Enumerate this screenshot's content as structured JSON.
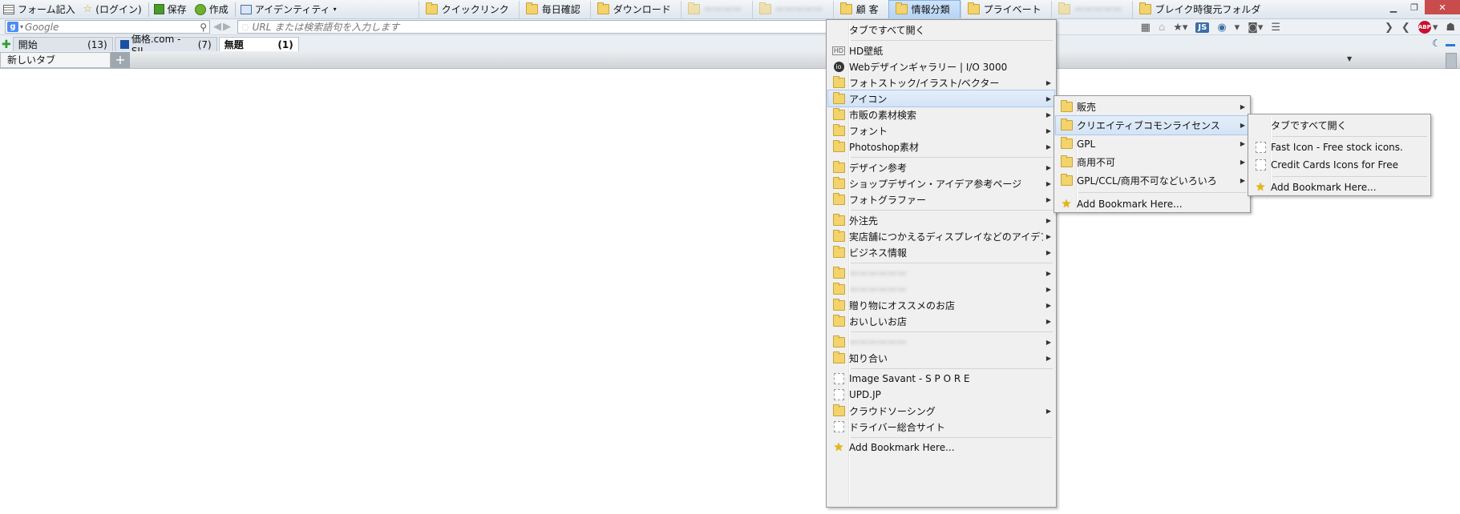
{
  "bookmarks_bar": {
    "items": [
      {
        "label": "フォーム記入",
        "icon": "form-icon"
      },
      {
        "label": "(ログイン)",
        "icon": "star-login-icon"
      },
      {
        "label": "保存",
        "icon": "save-icon"
      },
      {
        "label": "作成",
        "icon": "create-icon"
      },
      {
        "label": "アイデンティティ",
        "icon": "identity-icon"
      }
    ],
    "folders": [
      "クイックリンク",
      "毎日確認",
      "ダウンロード",
      "",
      "",
      "顧 客",
      "情報分類",
      "プライベート",
      "",
      "ブレイク時復元フォルダ"
    ],
    "window_buttons": [
      "minimize",
      "restore",
      "close"
    ]
  },
  "nav_bar": {
    "search_placeholder": "Google",
    "url_placeholder": "URL または検索語句を入力します",
    "tools": [
      "js-badge",
      "abp-badge"
    ],
    "js_label": "JS",
    "abp_label": "ABP"
  },
  "tabs": [
    {
      "label": "開始",
      "count": "(13)"
    },
    {
      "label": "価格.com - SIL...",
      "count": "(7)"
    },
    {
      "label": "無題",
      "count": "(1)"
    }
  ],
  "new_tab_label": "新しいタブ",
  "menu_main": {
    "items": [
      {
        "label": "タブですべて開く",
        "icon": "none",
        "submenu": false
      },
      {
        "sep": true
      },
      {
        "label": "HD壁紙",
        "icon": "hd-icon",
        "submenu": false
      },
      {
        "label": "Webデザインギャラリー | I/O 3000",
        "icon": "io-icon",
        "submenu": false
      },
      {
        "label": "フォトストック/イラスト/ベクター",
        "icon": "folder",
        "submenu": true
      },
      {
        "label": "アイコン",
        "icon": "folder",
        "submenu": true,
        "hover": true
      },
      {
        "label": "市販の素材検索",
        "icon": "folder",
        "submenu": true
      },
      {
        "label": "フォント",
        "icon": "folder",
        "submenu": true
      },
      {
        "label": "Photoshop素材",
        "icon": "folder",
        "submenu": true
      },
      {
        "sep": true
      },
      {
        "label": "デザイン参考",
        "icon": "folder",
        "submenu": true
      },
      {
        "label": "ショップデザイン・アイデア参考ページ",
        "icon": "folder",
        "submenu": true
      },
      {
        "label": "フォトグラファー",
        "icon": "folder",
        "submenu": true
      },
      {
        "sep": true
      },
      {
        "label": "外注先",
        "icon": "folder",
        "submenu": true
      },
      {
        "label": "実店舗につかえるディスプレイなどのアイデア",
        "icon": "folder",
        "submenu": true
      },
      {
        "label": "ビジネス情報",
        "icon": "folder",
        "submenu": true
      },
      {
        "sep": true
      },
      {
        "label": "",
        "icon": "folder",
        "submenu": true,
        "blurred": true
      },
      {
        "label": "",
        "icon": "folder",
        "submenu": true,
        "blurred": true
      },
      {
        "label": "贈り物にオススメのお店",
        "icon": "folder",
        "submenu": true
      },
      {
        "label": "おいしいお店",
        "icon": "folder",
        "submenu": true
      },
      {
        "sep": true
      },
      {
        "label": "",
        "icon": "folder",
        "submenu": true,
        "blurred": true
      },
      {
        "label": "知り合い",
        "icon": "folder",
        "submenu": true
      },
      {
        "sep": true
      },
      {
        "label": "Image Savant - S P O R E",
        "icon": "page",
        "submenu": false
      },
      {
        "label": "UPD.JP",
        "icon": "page",
        "submenu": false
      },
      {
        "label": "クラウドソーシング",
        "icon": "folder",
        "submenu": true
      },
      {
        "label": "ドライバー総合サイト",
        "icon": "page",
        "submenu": false
      },
      {
        "sep": true
      },
      {
        "label": "Add Bookmark Here...",
        "icon": "star",
        "submenu": false
      }
    ]
  },
  "menu_icons": {
    "items": [
      {
        "label": "販売",
        "icon": "folder",
        "submenu": true
      },
      {
        "label": "クリエイティブコモンライセンス",
        "icon": "folder",
        "submenu": true,
        "hover": true
      },
      {
        "label": "GPL",
        "icon": "folder",
        "submenu": true
      },
      {
        "label": "商用不可",
        "icon": "folder",
        "submenu": true
      },
      {
        "label": "GPL/CCL/商用不可などいろいろ",
        "icon": "folder",
        "submenu": true
      },
      {
        "sep": true
      },
      {
        "label": "Add Bookmark Here...",
        "icon": "star",
        "submenu": false
      }
    ]
  },
  "menu_cc": {
    "items": [
      {
        "label": "タブですべて開く",
        "icon": "none",
        "submenu": false
      },
      {
        "sep": true
      },
      {
        "label": "Fast Icon - Free stock icons.",
        "icon": "page",
        "submenu": false
      },
      {
        "label": "Credit Cards Icons for Free",
        "icon": "page",
        "submenu": false
      },
      {
        "sep": true
      },
      {
        "label": "Add Bookmark Here...",
        "icon": "star",
        "submenu": false
      }
    ]
  }
}
